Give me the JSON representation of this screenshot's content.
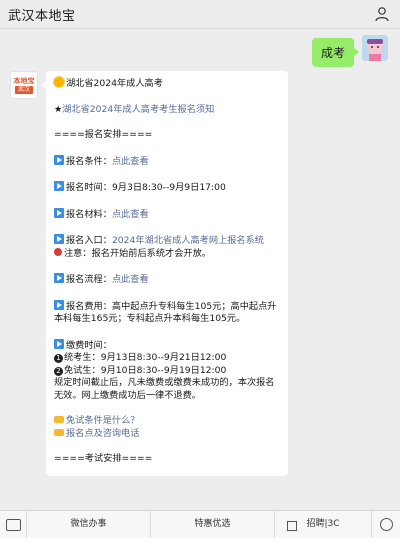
{
  "header": {
    "title": "武汉本地宝",
    "profile_icon": "user-icon"
  },
  "outgoing": {
    "text": "成考"
  },
  "bot_avatar": {
    "line1": "本地宝",
    "line2": "武汉"
  },
  "message": {
    "title": "湖北省2024年成人高考",
    "notice_link": "湖北省2024年成人高考考生报名须知",
    "section1": "====报名安排====",
    "cond_label": "报名条件：",
    "cond_link": "点此查看",
    "time_label": "报名时间：",
    "time_value": "9月3日8:30--9月9日17:00",
    "material_label": "报名材料：",
    "material_link": "点此查看",
    "entry_label": "报名入口：",
    "entry_link": "2024年湖北省成人高考网上报名系统",
    "note": "注意：报名开始前后系统才会开放。",
    "process_label": "报名流程：",
    "process_link": "点此查看",
    "fee_text": "报名费用：高中起点升专科每生105元；高中起点升本科每生165元；专科起点升本科每生105元。",
    "pay_title": "缴费时间：",
    "pay1": "统考生：9月13日8:30--9月21日12:00",
    "pay2": "免试生：9月10日8:30--9月19日12:00",
    "pay_note": "规定时间截止后，凡未缴费或缴费未成功的，本次报名无效。网上缴费成功后一律不退费。",
    "faq1": "免试条件是什么？",
    "faq2": "报名点及咨询电话",
    "section2": "====考试安排===="
  },
  "bottom_menu": {
    "item1": "微信办事",
    "item2": "特惠优选",
    "item3": "招聘|3C"
  }
}
